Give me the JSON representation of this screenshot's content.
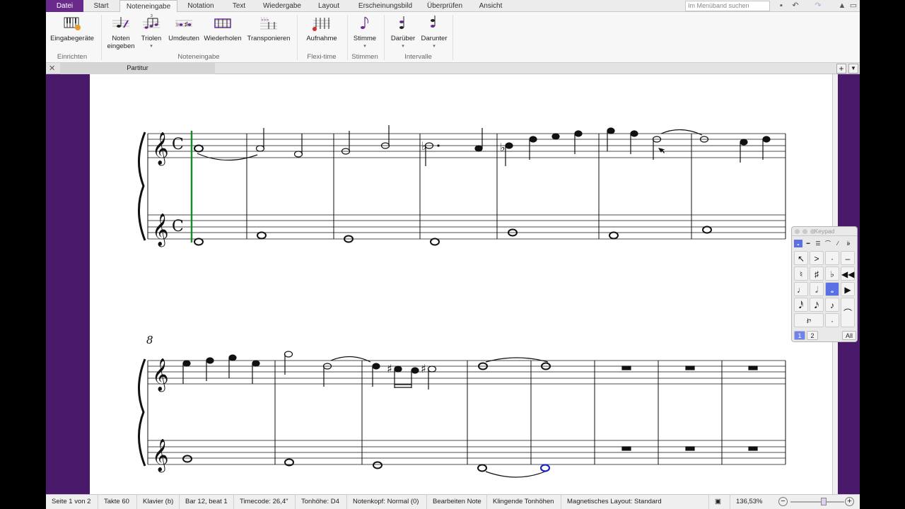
{
  "menu_tabs": [
    "Datei",
    "Start",
    "Noteneingabe",
    "Notation",
    "Text",
    "Wiedergabe",
    "Layout",
    "Erscheinungsbild",
    "Überprüfen",
    "Ansicht"
  ],
  "active_tab": "Noteneingabe",
  "search_placeholder": "Im Menüband suchen",
  "ribbon": {
    "buttons": [
      "Eingabegeräte",
      "Noten\neingeben",
      "Triolen",
      "Umdeuten",
      "Wiederholen",
      "Transponieren",
      "Aufnahme",
      "Stimme",
      "Darüber",
      "Darunter"
    ],
    "groups": [
      "Einrichten",
      "Noteneingabe",
      "Flexi-time",
      "Stimmen",
      "Intervalle"
    ]
  },
  "document_tab": "Partitur",
  "score": {
    "measure_number_system2": "8",
    "time_signature": "C"
  },
  "keypad": {
    "title": "Keypad",
    "layouts": [
      "1",
      "2"
    ],
    "all_label": "All",
    "selected_layout": "1",
    "selected_key": "whole-note"
  },
  "status": {
    "page": "Seite 1 von 2",
    "bars": "Takte 60",
    "instrument": "Klavier (b)",
    "position": "Bar 12, beat 1",
    "timecode": "Timecode: 26,4\"",
    "pitch": "Tonhöhe: D4",
    "notehead": "Notenkopf: Normal (0)",
    "mode": "Bearbeiten Note",
    "sounding": "Klingende Tonhöhen",
    "layout": "Magnetisches Layout: Standard",
    "zoom": "136,53%"
  },
  "colors": {
    "file_tab": "#6a2a8c",
    "workspace": "#4a1a6a",
    "playback_line": "#1a8a2a",
    "selected_note": "#1a22cc",
    "keypad_selected": "#5b6fe6"
  }
}
